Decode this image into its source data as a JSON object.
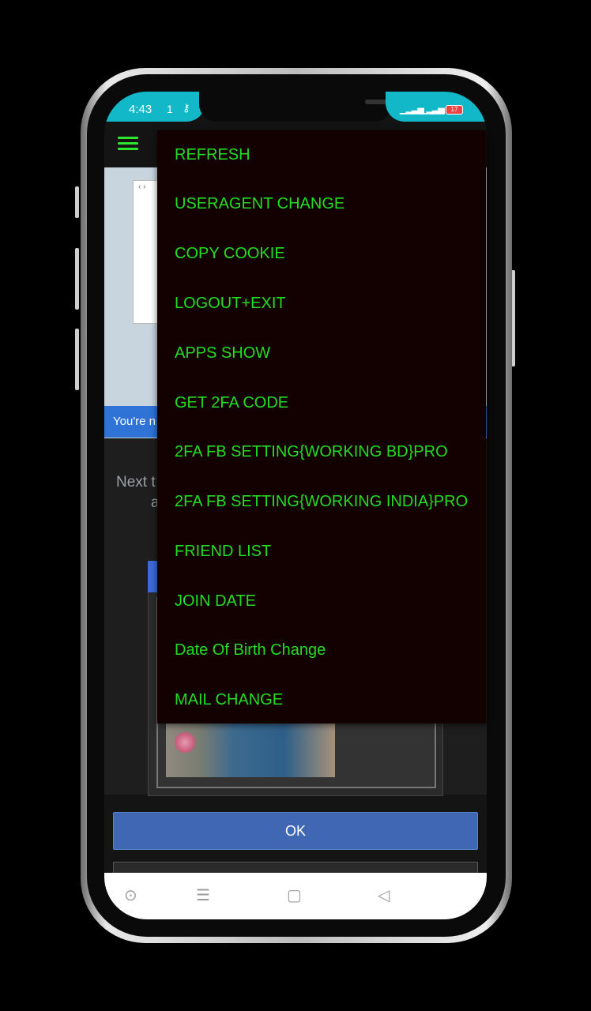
{
  "status_bar": {
    "time": "4:43",
    "net_speed": "1",
    "battery": "17"
  },
  "web_content": {
    "banner_text": "You're n",
    "next_line1": "Next t",
    "next_line2": "a"
  },
  "buttons": {
    "ok_label": "OK"
  },
  "menu": {
    "items": [
      {
        "label": "REFRESH"
      },
      {
        "label": "USERAGENT CHANGE"
      },
      {
        "label": "COPY COOKIE"
      },
      {
        "label": "LOGOUT+EXIT"
      },
      {
        "label": "APPS SHOW"
      },
      {
        "label": "GET 2FA CODE"
      },
      {
        "label": "2FA FB SETTING{WORKING BD}PRO"
      },
      {
        "label": "2FA FB SETTING{WORKING INDIA}PRO"
      },
      {
        "label": "FRIEND LIST"
      },
      {
        "label": "JOIN DATE"
      },
      {
        "label": "Date Of Birth Change"
      },
      {
        "label": "MAIL CHANGE"
      }
    ],
    "text_color": "#22dd22",
    "background_color": "#130000"
  },
  "nav_bar": {
    "icons": [
      "circle-icon",
      "menu-lines-icon",
      "square-icon",
      "back-triangle-icon"
    ]
  },
  "colors": {
    "status_bar_accent": "#13b8c8",
    "hamburger": "#2ee62e",
    "ok_button": "#4067b4",
    "banner": "#2f73d6"
  }
}
